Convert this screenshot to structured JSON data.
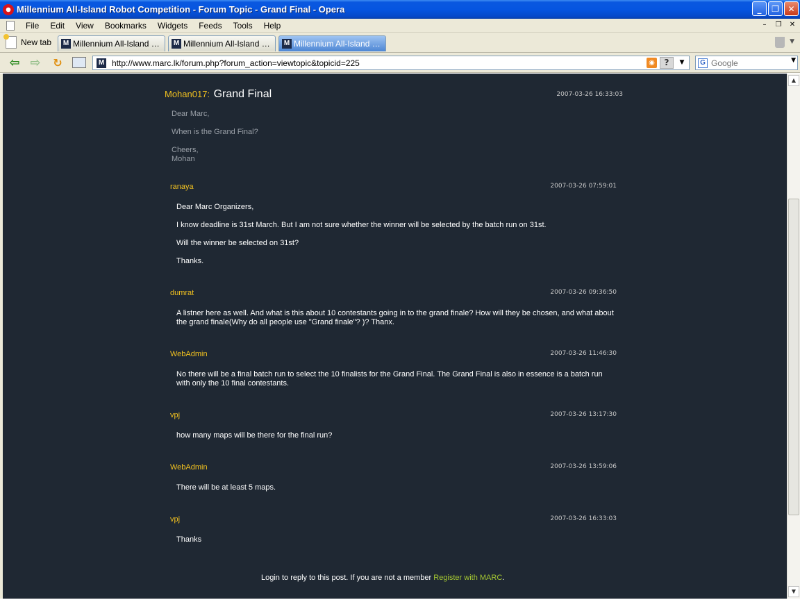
{
  "window": {
    "title": "Millennium All-Island Robot Competition - Forum Topic - Grand Final - Opera",
    "buttons": {
      "minimize": "_",
      "maximize": "❐",
      "close": "✕"
    }
  },
  "menubar": {
    "items": [
      "File",
      "Edit",
      "View",
      "Bookmarks",
      "Widgets",
      "Feeds",
      "Tools",
      "Help"
    ]
  },
  "tabs": {
    "new_tab_label": "New tab",
    "items": [
      {
        "label": "Millennium All-Island Rob..."
      },
      {
        "label": "Millennium All-Island Rob..."
      },
      {
        "label": "Millennium All-Island Rob..."
      }
    ],
    "active_index": 2
  },
  "address": {
    "url": "http://www.marc.lk/forum.php?forum_action=viewtopic&topicid=225",
    "search_placeholder": "Google"
  },
  "topic": {
    "author": "Mohan017:",
    "title": "Grand Final",
    "date": "2007-03-26 16:33:03",
    "body": [
      "Dear Marc,",
      "When is the Grand Final?",
      "Cheers,",
      "Mohan"
    ]
  },
  "posts": [
    {
      "author": "ranaya",
      "date": "2007-03-26 07:59:01",
      "body": [
        "Dear Marc Organizers,",
        "I know deadline is 31st March. But I am not sure whether the winner will be selected by the batch run on 31st.",
        "Will the winner be selected on 31st?",
        "Thanks."
      ]
    },
    {
      "author": "dumrat",
      "date": "2007-03-26 09:36:50",
      "body": [
        "A listner here as well. And what is this about 10 contestants going in to the grand finale? How will they be chosen, and what about the grand finale(Why do all people use \"Grand finale\"? )? Thanx."
      ]
    },
    {
      "author": "WebAdmin",
      "date": "2007-03-26 11:46:30",
      "body": [
        "No there will be a final batch run to select the 10 finalists for the Grand Final. The Grand Final is also in essence is a batch run with only the 10 final contestants."
      ]
    },
    {
      "author": "vpj",
      "date": "2007-03-26 13:17:30",
      "body": [
        "how many maps will be there for the final run?"
      ]
    },
    {
      "author": "WebAdmin",
      "date": "2007-03-26 13:59:06",
      "body": [
        "There will be at least 5 maps."
      ]
    },
    {
      "author": "vpj",
      "date": "2007-03-26 16:33:03",
      "body": [
        "Thanks"
      ]
    }
  ],
  "footer": {
    "text": "Login to reply to this post. If you are not a member ",
    "link": "Register with MARC",
    "end": "."
  },
  "colors": {
    "page_bg": "#1f2833",
    "author": "#f0c020",
    "link": "#a6c932"
  }
}
